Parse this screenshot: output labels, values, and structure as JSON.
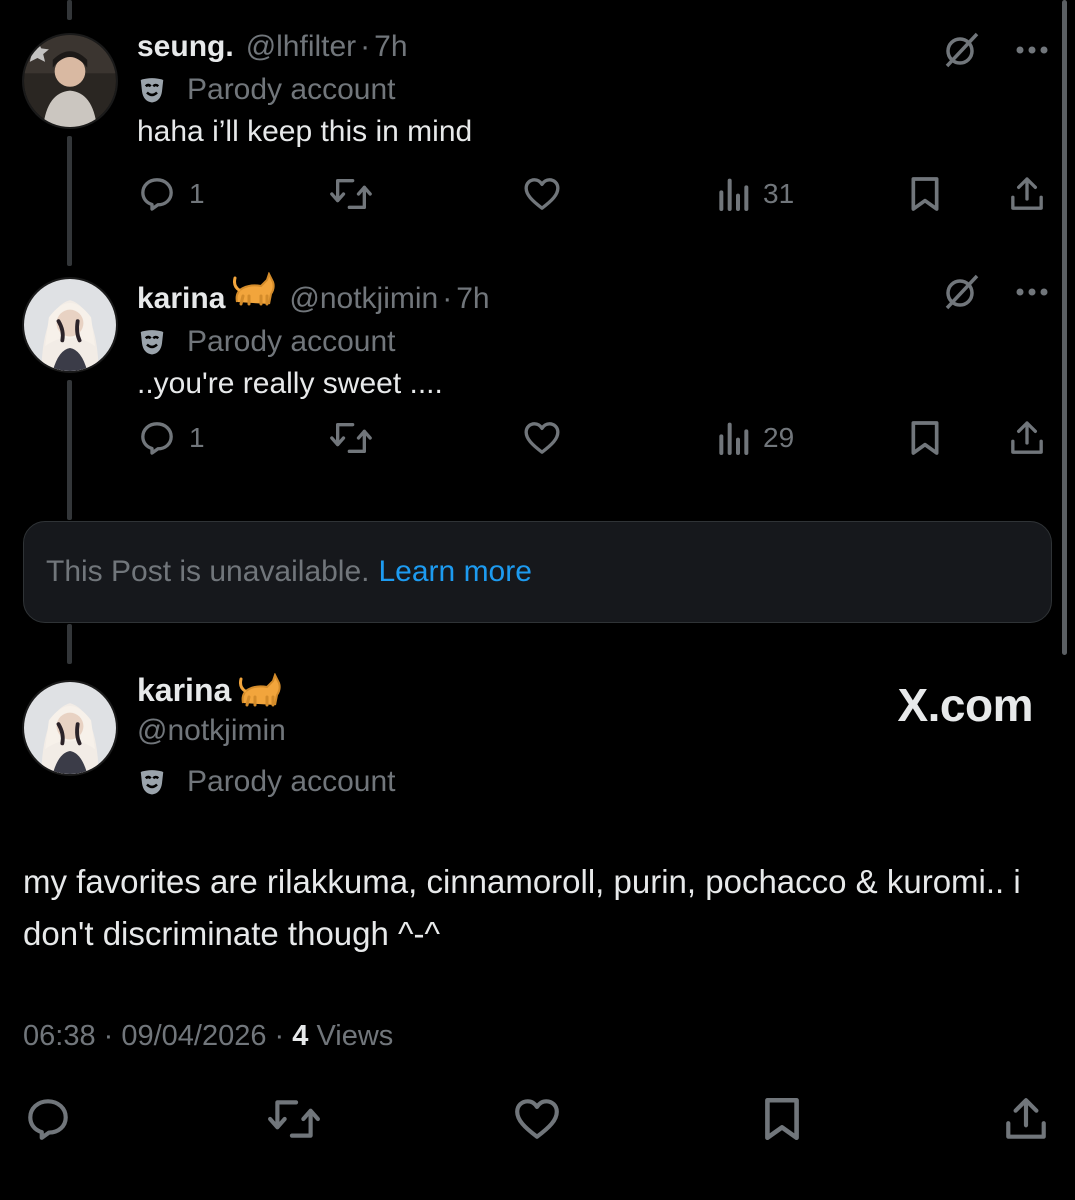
{
  "posts": [
    {
      "name": "seung.",
      "handle": "@lhfilter",
      "separator": "·",
      "time": "7h",
      "badge": "Parody account",
      "text": "haha i’ll keep this in mind",
      "replies": "1",
      "views": "31"
    },
    {
      "name": "karina",
      "emoji": "cat-emoji",
      "handle": "@notkjimin",
      "separator": "·",
      "time": "7h",
      "badge": "Parody account",
      "text": "..you're really sweet ....",
      "replies": "1",
      "views": "29"
    }
  ],
  "unavailable": {
    "text": "This Post is unavailable.",
    "link": "Learn more"
  },
  "main_post": {
    "name": "karina",
    "emoji": "cat-emoji",
    "handle": "@notkjimin",
    "badge": "Parody account",
    "text": "my favorites are rilakkuma, cinnamoroll, purin, pochacco & kuromi.. i don't discriminate though ^-^",
    "timestamp": "06:38 · 09/04/2026 · ",
    "views_count": "4",
    "views_label": " Views"
  },
  "watermark": "X.com",
  "colors": {
    "background": "#000000",
    "text": "#e7e9ea",
    "muted": "#71767b",
    "link": "#1d9bf0",
    "card": "#16181c"
  },
  "icons": [
    "reply-icon",
    "repost-icon",
    "like-icon",
    "views-icon",
    "bookmark-icon",
    "share-icon",
    "grok-icon",
    "more-icon",
    "parody-mask-icon"
  ]
}
